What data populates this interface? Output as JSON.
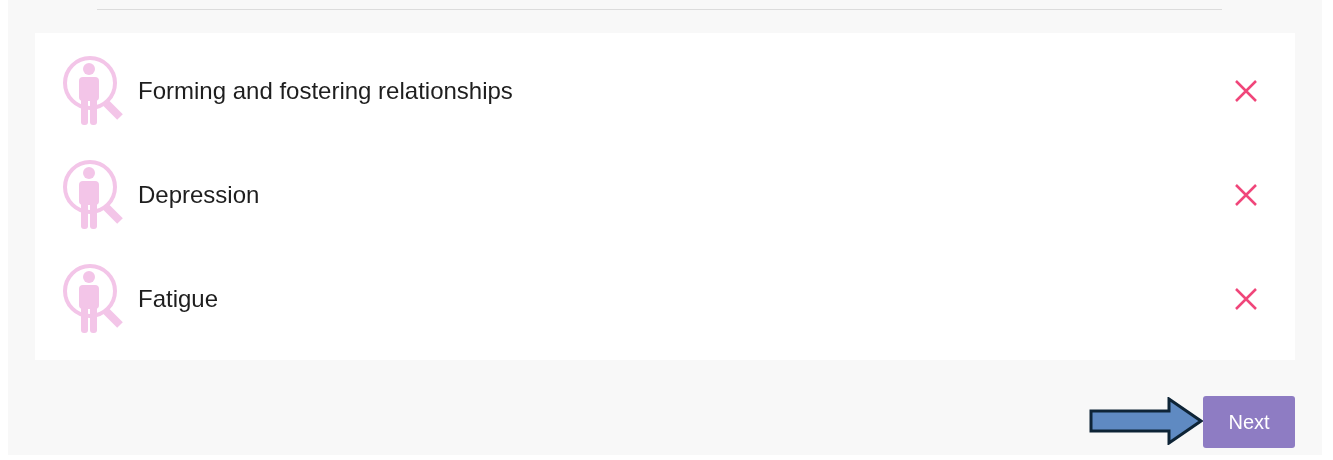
{
  "items": [
    {
      "label": "Forming and fostering relationships"
    },
    {
      "label": "Depression"
    },
    {
      "label": "Fatigue"
    }
  ],
  "next_button": {
    "label": "Next"
  }
}
